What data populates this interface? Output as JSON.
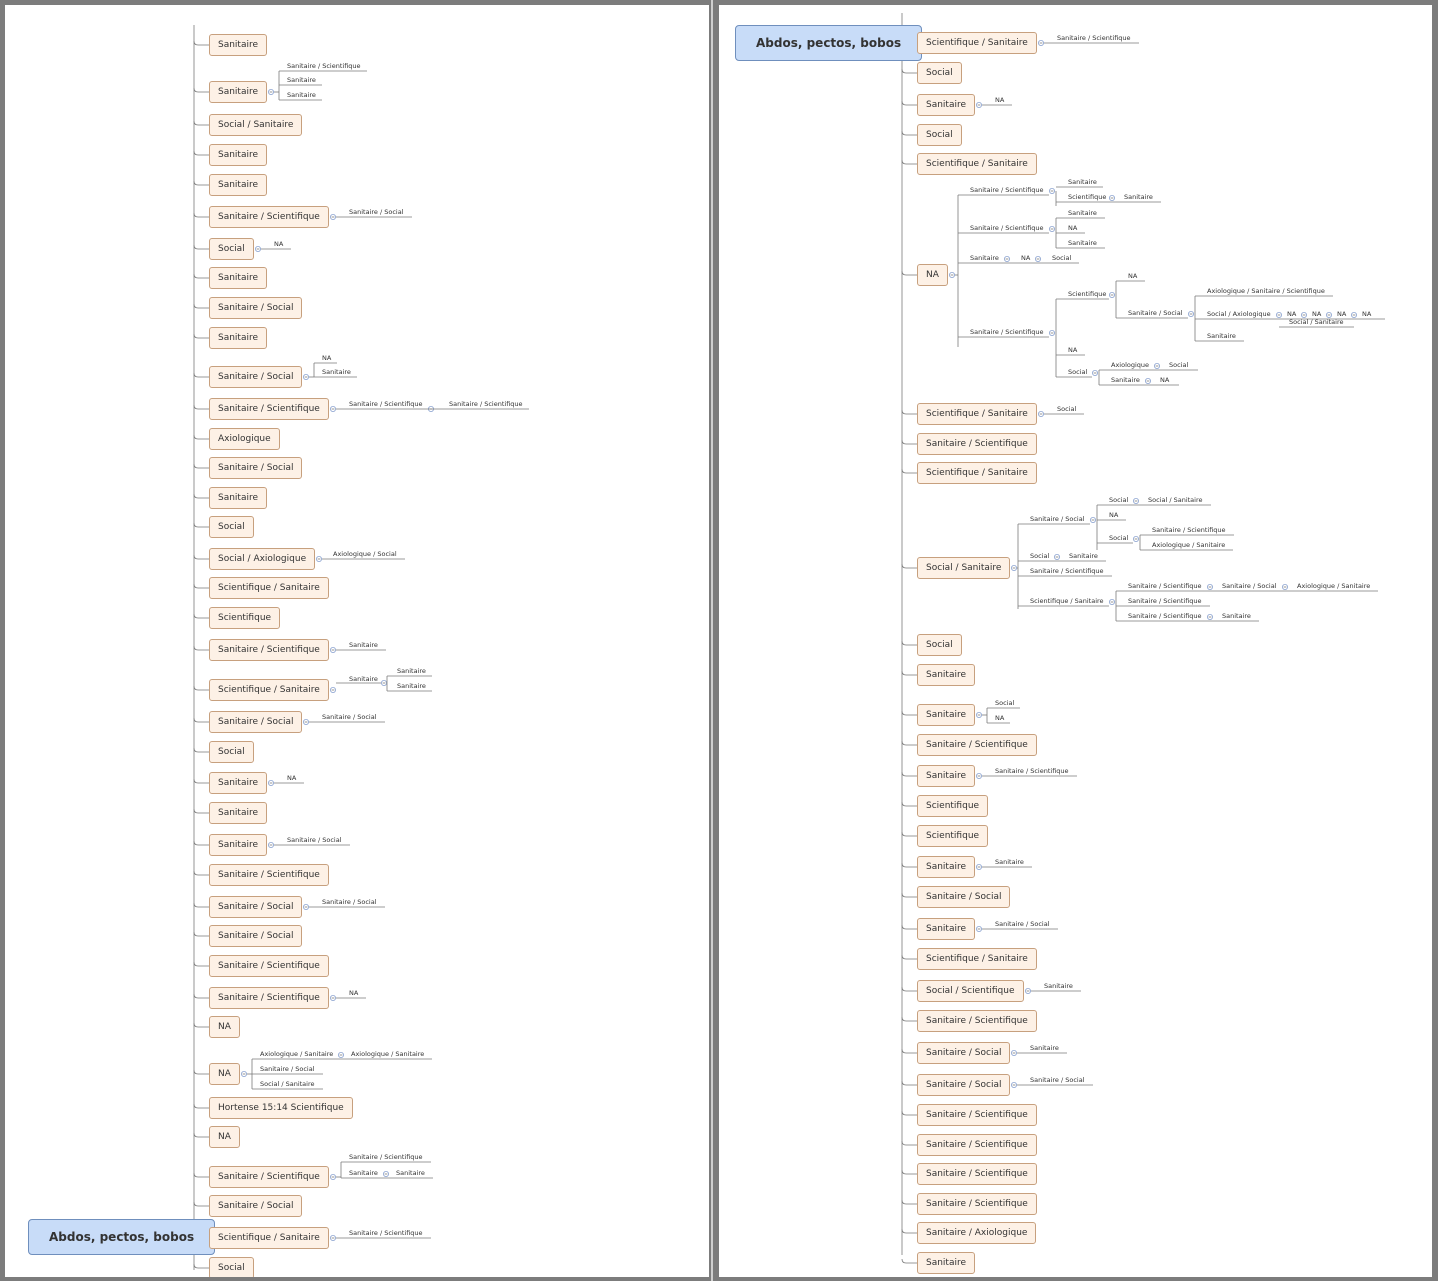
{
  "left": {
    "root": "Abdos, pectos, bobos",
    "items": [
      {
        "label": "Sanitaire",
        "children": []
      },
      {
        "label": "Sanitaire",
        "children": [
          "Sanitaire / Scientifique",
          "Sanitaire",
          "Sanitaire"
        ]
      },
      {
        "label": "Social / Sanitaire",
        "children": []
      },
      {
        "label": "Sanitaire",
        "children": []
      },
      {
        "label": "Sanitaire",
        "children": []
      },
      {
        "label": "Sanitaire / Scientifique",
        "children": [
          "Sanitaire / Social"
        ]
      },
      {
        "label": "Social",
        "children": [
          "NA"
        ]
      },
      {
        "label": "Sanitaire",
        "children": []
      },
      {
        "label": "Sanitaire / Social",
        "children": []
      },
      {
        "label": "Sanitaire",
        "children": []
      },
      {
        "label": "Sanitaire / Social",
        "children": [
          "NA",
          "Sanitaire"
        ]
      },
      {
        "label": "Sanitaire / Scientifique",
        "children": [
          "Sanitaire / Scientifique",
          "Sanitaire / Scientifique"
        ]
      },
      {
        "label": "Axiologique",
        "children": []
      },
      {
        "label": "Sanitaire / Social",
        "children": []
      },
      {
        "label": "Sanitaire",
        "children": []
      },
      {
        "label": "Social",
        "children": []
      },
      {
        "label": "Social / Axiologique",
        "children": [
          "Axiologique / Social"
        ]
      },
      {
        "label": "Scientifique / Sanitaire",
        "children": []
      },
      {
        "label": "Scientifique",
        "children": []
      },
      {
        "label": "Sanitaire / Scientifique",
        "children": [
          "Sanitaire"
        ]
      },
      {
        "label": "Scientifique / Sanitaire",
        "children": [
          "Sanitaire",
          "Sanitaire",
          "Sanitaire"
        ]
      },
      {
        "label": "Sanitaire / Social",
        "children": [
          "Sanitaire / Social"
        ]
      },
      {
        "label": "Social",
        "children": []
      },
      {
        "label": "Sanitaire",
        "children": [
          "NA"
        ]
      },
      {
        "label": "Sanitaire",
        "children": []
      },
      {
        "label": "Sanitaire",
        "children": [
          "Sanitaire / Social"
        ]
      },
      {
        "label": "Sanitaire / Scientifique",
        "children": []
      },
      {
        "label": "Sanitaire / Social",
        "children": [
          "Sanitaire / Social"
        ]
      },
      {
        "label": "Sanitaire / Social",
        "children": []
      },
      {
        "label": "Sanitaire / Scientifique",
        "children": []
      },
      {
        "label": "Sanitaire / Scientifique",
        "children": [
          "NA"
        ]
      },
      {
        "label": "NA",
        "children": []
      },
      {
        "label": "NA",
        "children": [
          "Axiologique / Sanitaire",
          "Axiologique / Sanitaire",
          "Sanitaire / Social",
          "Social / Sanitaire"
        ]
      },
      {
        "label": "Hortense 15:14 Scientifique",
        "children": []
      },
      {
        "label": "NA",
        "children": []
      },
      {
        "label": "Sanitaire / Scientifique",
        "children": [
          "Sanitaire / Scientifique",
          "Sanitaire",
          "Sanitaire"
        ]
      },
      {
        "label": "Sanitaire / Social",
        "children": []
      },
      {
        "label": "Scientifique / Sanitaire",
        "children": [
          "Sanitaire / Scientifique"
        ]
      },
      {
        "label": "Social",
        "children": []
      }
    ]
  },
  "right": {
    "root": "Abdos, pectos, bobos",
    "items": [
      {
        "label": "Scientifique / Sanitaire",
        "children": [
          "Sanitaire / Scientifique"
        ]
      },
      {
        "label": "Social",
        "children": []
      },
      {
        "label": "Sanitaire",
        "children": [
          "NA"
        ]
      },
      {
        "label": "Social",
        "children": []
      },
      {
        "label": "Scientifique / Sanitaire",
        "children": []
      },
      {
        "label": "NA",
        "children": [
          "Sanitaire / Scientifique",
          "Sanitaire",
          "Scientifique",
          "Sanitaire",
          "Sanitaire / Scientifique",
          "Sanitaire",
          "NA",
          "Sanitaire",
          "Sanitaire",
          "NA",
          "Social",
          "Sanitaire / Scientifique",
          "Scientifique",
          "NA",
          "Sanitaire / Social",
          "Axiologique / Sanitaire / Scientifique",
          "Social / Axiologique",
          "NA",
          "NA",
          "NA",
          "NA",
          "Social / Sanitaire",
          "Sanitaire",
          "NA",
          "Social",
          "Axiologique",
          "Social",
          "Sanitaire",
          "NA"
        ]
      },
      {
        "label": "Scientifique / Sanitaire",
        "children": [
          "Social"
        ]
      },
      {
        "label": "Sanitaire / Scientifique",
        "children": []
      },
      {
        "label": "Scientifique / Sanitaire",
        "children": []
      },
      {
        "label": "Social / Sanitaire",
        "children": [
          "Sanitaire / Social",
          "Social",
          "Social / Sanitaire",
          "NA",
          "Social",
          "Sanitaire / Scientifique",
          "Axiologique / Sanitaire",
          "Social",
          "Sanitaire",
          "Sanitaire / Scientifique",
          "Scientifique / Sanitaire",
          "Sanitaire / Scientifique",
          "Sanitaire / Social",
          "Axiologique / Sanitaire",
          "Sanitaire / Scientifique",
          "Sanitaire / Scientifique",
          "Sanitaire"
        ]
      },
      {
        "label": "Social",
        "children": []
      },
      {
        "label": "Sanitaire",
        "children": []
      },
      {
        "label": "Sanitaire",
        "children": [
          "Social",
          "NA"
        ]
      },
      {
        "label": "Sanitaire / Scientifique",
        "children": []
      },
      {
        "label": "Sanitaire",
        "children": [
          "Sanitaire / Scientifique"
        ]
      },
      {
        "label": "Scientifique",
        "children": []
      },
      {
        "label": "Scientifique",
        "children": []
      },
      {
        "label": "Sanitaire",
        "children": [
          "Sanitaire"
        ]
      },
      {
        "label": "Sanitaire / Social",
        "children": []
      },
      {
        "label": "Sanitaire",
        "children": [
          "Sanitaire / Social"
        ]
      },
      {
        "label": "Scientifique / Sanitaire",
        "children": []
      },
      {
        "label": "Social / Scientifique",
        "children": [
          "Sanitaire"
        ]
      },
      {
        "label": "Sanitaire / Scientifique",
        "children": []
      },
      {
        "label": "Sanitaire / Social",
        "children": [
          "Sanitaire"
        ]
      },
      {
        "label": "Sanitaire / Social",
        "children": [
          "Sanitaire / Social"
        ]
      },
      {
        "label": "Sanitaire / Scientifique",
        "children": []
      },
      {
        "label": "Sanitaire / Scientifique",
        "children": []
      },
      {
        "label": "Sanitaire / Scientifique",
        "children": []
      },
      {
        "label": "Sanitaire / Scientifique",
        "children": []
      },
      {
        "label": "Sanitaire / Axiologique",
        "children": []
      },
      {
        "label": "Sanitaire",
        "children": []
      }
    ]
  }
}
